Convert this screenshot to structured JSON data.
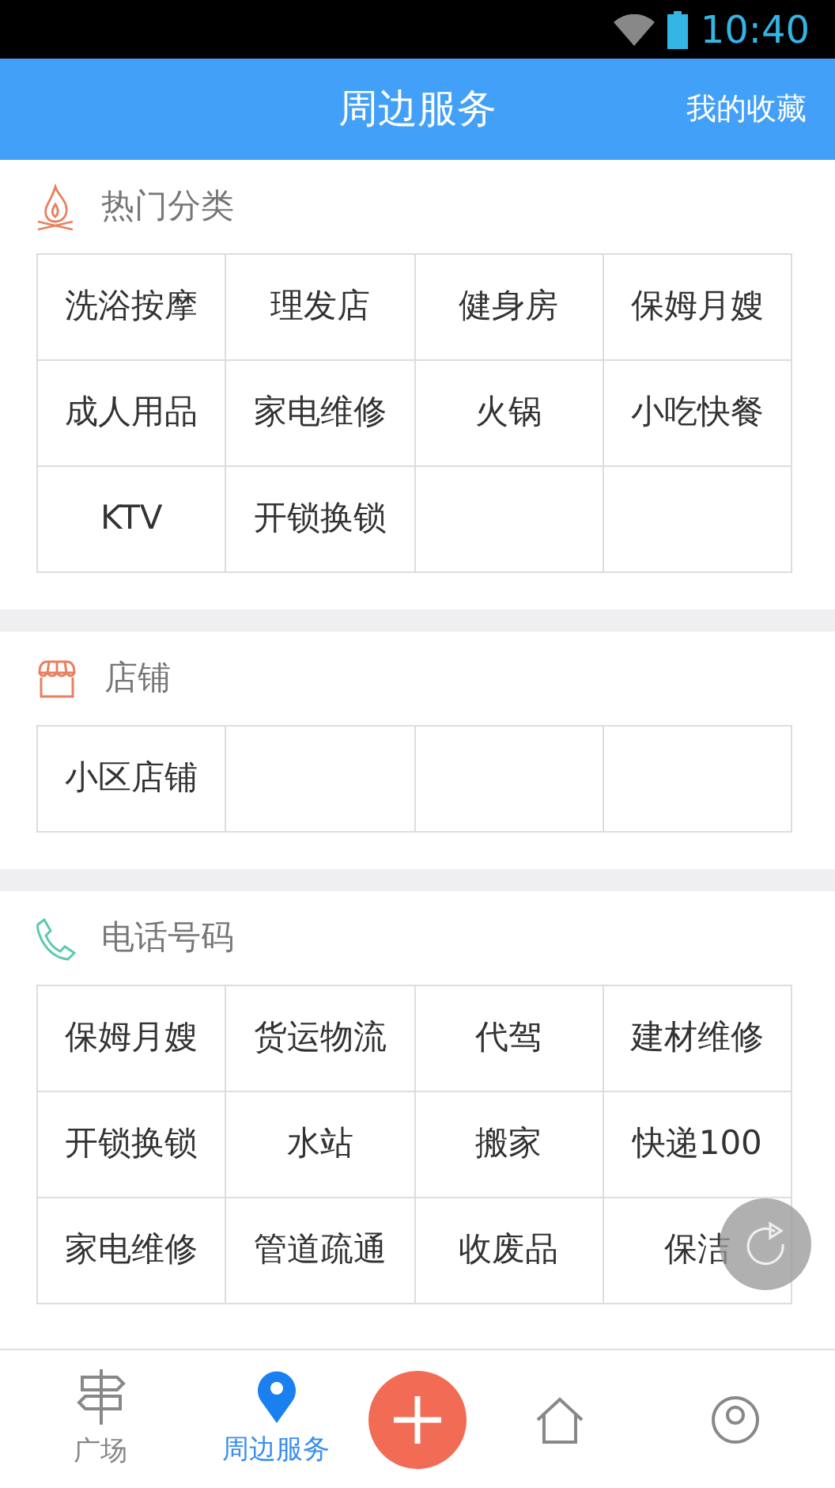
{
  "status_bar": {
    "time": "10:40"
  },
  "header": {
    "title": "周边服务",
    "action": "我的收藏"
  },
  "sections": [
    {
      "kind": "fire",
      "title": "热门分类",
      "cells": [
        "洗浴按摩",
        "理发店",
        "健身房",
        "保姆月嫂",
        "成人用品",
        "家电维修",
        "火锅",
        "小吃快餐",
        "KTV",
        "开锁换锁"
      ]
    },
    {
      "kind": "shop",
      "title": "店铺",
      "cells": [
        "小区店铺"
      ]
    },
    {
      "kind": "phone",
      "title": "电话号码",
      "cells": [
        "保姆月嫂",
        "货运物流",
        "代驾",
        "建材维修",
        "开锁换锁",
        "水站",
        "搬家",
        "快递100",
        "家电维修",
        "管道疏通",
        "收废品",
        "保洁"
      ]
    }
  ],
  "bottom_nav": [
    {
      "kind": "signpost",
      "label": "广场",
      "selected": false
    },
    {
      "kind": "pin",
      "label": "周边服务",
      "selected": true
    },
    {
      "kind": "add",
      "selected": false
    },
    {
      "kind": "home",
      "selected": false
    },
    {
      "kind": "profile",
      "selected": false
    }
  ]
}
